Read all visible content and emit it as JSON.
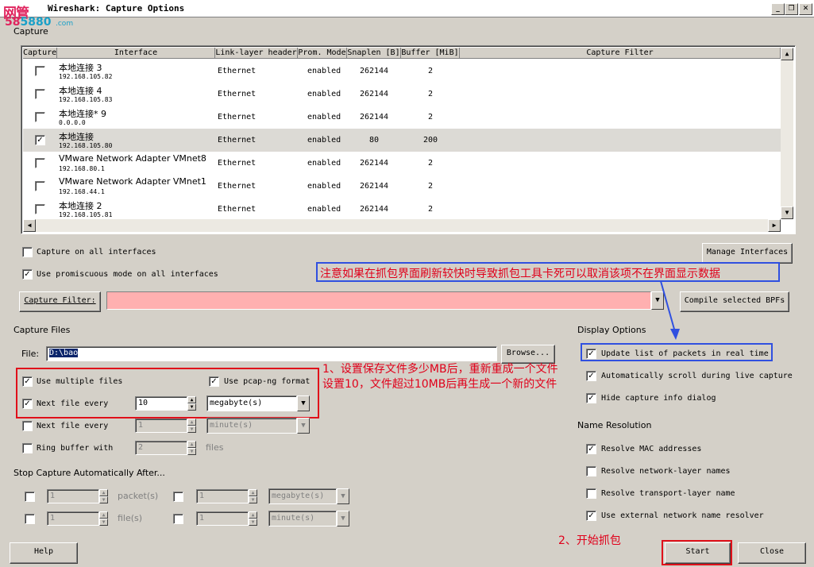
{
  "window": {
    "title": "Wireshark: Capture Options",
    "controls": [
      "_",
      "❐",
      "✕"
    ]
  },
  "watermark": {
    "line1": "网管",
    "line2": "5880",
    "suffix": ".com"
  },
  "capture_group": {
    "label": "Capture"
  },
  "table": {
    "columns": [
      "Capture",
      "Interface",
      "Link-layer header",
      "Prom. Mode",
      "Snaplen [B]",
      "Buffer [MiB]",
      "Capture Filter"
    ],
    "rows": [
      {
        "checked": false,
        "name": "本地连接 3",
        "ip": "192.168.105.82",
        "link": "Ethernet",
        "prom": "enabled",
        "snaplen": "262144",
        "buffer": "2",
        "filter": ""
      },
      {
        "checked": false,
        "name": "本地连接 4",
        "ip": "192.168.105.83",
        "link": "Ethernet",
        "prom": "enabled",
        "snaplen": "262144",
        "buffer": "2",
        "filter": ""
      },
      {
        "checked": false,
        "name": "本地连接* 9",
        "ip": "0.0.0.0",
        "link": "Ethernet",
        "prom": "enabled",
        "snaplen": "262144",
        "buffer": "2",
        "filter": ""
      },
      {
        "checked": true,
        "name": "本地连接",
        "ip": "192.168.105.80",
        "link": "Ethernet",
        "prom": "enabled",
        "snaplen": "80",
        "buffer": "200",
        "filter": ""
      },
      {
        "checked": false,
        "name": "VMware Network Adapter VMnet8",
        "ip": "192.168.80.1",
        "link": "Ethernet",
        "prom": "enabled",
        "snaplen": "262144",
        "buffer": "2",
        "filter": ""
      },
      {
        "checked": false,
        "name": "VMware Network Adapter VMnet1",
        "ip": "192.168.44.1",
        "link": "Ethernet",
        "prom": "enabled",
        "snaplen": "262144",
        "buffer": "2",
        "filter": ""
      },
      {
        "checked": false,
        "name": "本地连接 2",
        "ip": "192.168.105.81",
        "link": "Ethernet",
        "prom": "enabled",
        "snaplen": "262144",
        "buffer": "2",
        "filter": ""
      }
    ]
  },
  "options": {
    "capture_all": {
      "label": "Capture on all interfaces",
      "checked": false
    },
    "promiscuous": {
      "label": "Use promiscuous mode on all interfaces",
      "checked": true
    },
    "manage_interfaces": "Manage Interfaces",
    "capture_filter_button": "Capture Filter:",
    "capture_filter_value": "",
    "compile_bpfs": "Compile selected BPFs"
  },
  "capture_files": {
    "label": "Capture Files",
    "file_label": "File:",
    "file_value": "D:\\bao",
    "browse": "Browse...",
    "use_multiple": {
      "label": "Use multiple files",
      "checked": true
    },
    "pcapng": {
      "label": "Use pcap-ng format",
      "checked": true
    },
    "next_file_size": {
      "label": "Next file every",
      "checked": true,
      "value": "10",
      "unit": "megabyte(s)"
    },
    "next_file_time": {
      "label": "Next file every",
      "checked": false,
      "value": "1",
      "unit": "minute(s)"
    },
    "ring_buffer": {
      "label": "Ring buffer with",
      "checked": false,
      "value": "2",
      "unit": "files"
    }
  },
  "stop_capture": {
    "label": "Stop Capture Automatically After...",
    "packets": {
      "checked": false,
      "value": "1",
      "unit": "packet(s)"
    },
    "size": {
      "checked": false,
      "value": "1",
      "unit": "megabyte(s)"
    },
    "files": {
      "checked": false,
      "value": "1",
      "unit": "file(s)"
    },
    "time": {
      "checked": false,
      "value": "1",
      "unit": "minute(s)"
    }
  },
  "display_options": {
    "label": "Display Options",
    "update_realtime": {
      "label": "Update list of packets in real time",
      "checked": true
    },
    "auto_scroll": {
      "label": "Automatically scroll during live capture",
      "checked": true
    },
    "hide_info": {
      "label": "Hide capture info dialog",
      "checked": true
    }
  },
  "name_resolution": {
    "label": "Name Resolution",
    "mac": {
      "label": "Resolve MAC addresses",
      "checked": true
    },
    "network": {
      "label": "Resolve network-layer names",
      "checked": false
    },
    "transport": {
      "label": "Resolve transport-layer name",
      "checked": false
    },
    "external": {
      "label": "Use external network name resolver",
      "checked": true
    }
  },
  "buttons": {
    "help": "Help",
    "start": "Start",
    "close": "Close"
  },
  "annotations": {
    "blue_note": "注意如果在抓包界面刷新较快时导致抓包工具卡死可以取消该项不在界面显示数据",
    "note1_line1": "1、设置保存文件多少MB后，重新重成一个文件",
    "note1_line2": "设置10，文件超过10MB后再生成一个新的文件",
    "note2": "2、开始抓包"
  },
  "colors": {
    "filter_bg": "#ffb0b0",
    "annotation_red": "#e0101a",
    "annotation_blue": "#3050e0",
    "selected_row": "#dcdad5"
  }
}
